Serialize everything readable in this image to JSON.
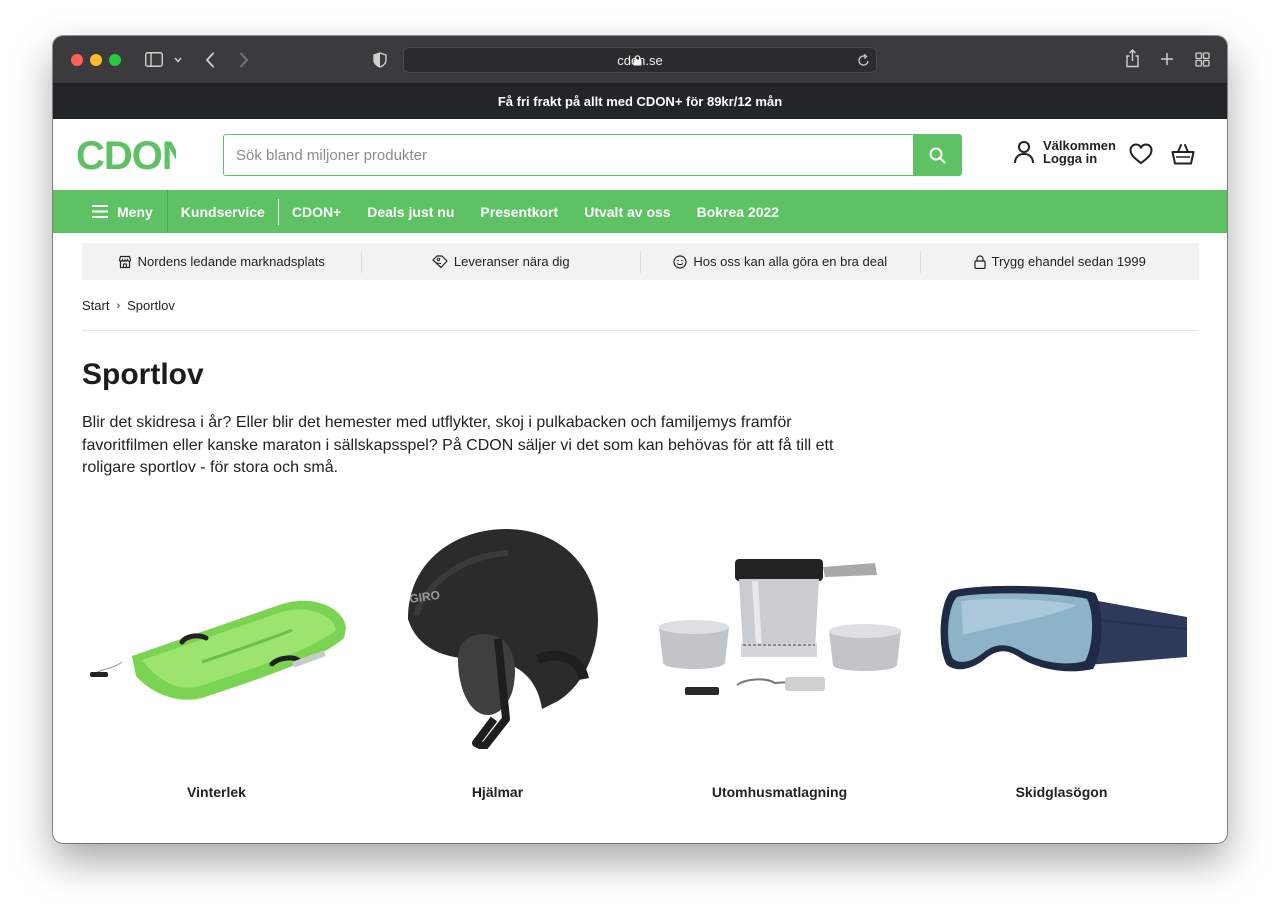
{
  "browser": {
    "url": "cdon.se"
  },
  "promo": {
    "text": "Få fri frakt på allt med CDON+ för 89kr/12 mån"
  },
  "header": {
    "logo": "CDON",
    "search_placeholder": "Sök bland miljoner produkter",
    "welcome": "Välkommen",
    "login": "Logga in"
  },
  "nav": {
    "menu_label": "Meny",
    "items": [
      "Kundservice",
      "CDON+",
      "Deals just nu",
      "Presentkort",
      "Utvalt av oss",
      "Bokrea 2022"
    ]
  },
  "usp": [
    {
      "icon": "store-icon",
      "text": "Nordens ledande marknadsplats"
    },
    {
      "icon": "delivery-tag-icon",
      "text": "Leveranser nära dig"
    },
    {
      "icon": "smiley-icon",
      "text": "Hos oss kan alla göra en bra deal"
    },
    {
      "icon": "lock-icon",
      "text": "Trygg ehandel sedan 1999"
    }
  ],
  "breadcrumb": {
    "start": "Start",
    "current": "Sportlov"
  },
  "page": {
    "title": "Sportlov",
    "description": "Blir det skidresa i år? Eller blir det hemester med utflykter, skoj i pulkabacken och familjemys framför favoritfilmen eller kanske maraton i sällskapsspel? På CDON säljer vi det som kan behövas för att få till ett roligare sportlov - för stora och små."
  },
  "categories": [
    {
      "name": "Vinterlek",
      "image": "green-sled-image"
    },
    {
      "name": "Hjälmar",
      "image": "ski-helmet-image",
      "helmet_brand": "GIRO"
    },
    {
      "name": "Utomhusmatlagning",
      "image": "camping-stove-image"
    },
    {
      "name": "Skidglasögon",
      "image": "ski-goggles-image"
    }
  ],
  "colors": {
    "brand_green": "#5ec164",
    "promo_bg": "#222629"
  }
}
